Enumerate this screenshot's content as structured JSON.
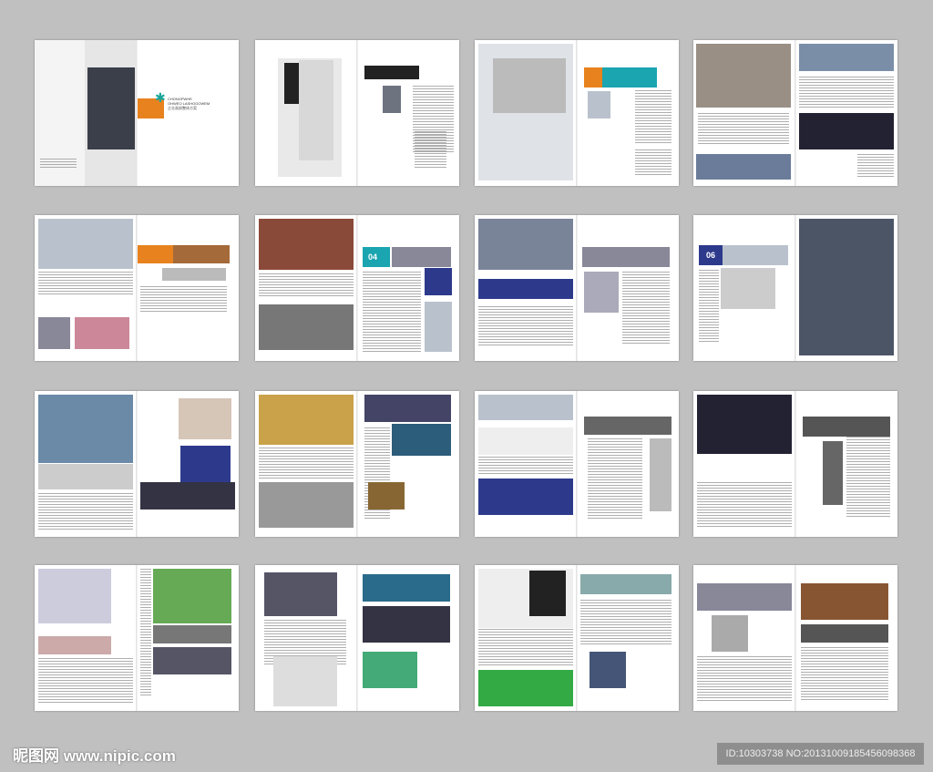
{
  "cover": {
    "logo_line1": "CHONGPWHE",
    "logo_line2": "OHWEO LASHOGOWEM",
    "logo_cn": "企业画册整体方案"
  },
  "page_numbers": [
    "04",
    "06"
  ],
  "colors": {
    "background": "#c0c0c0",
    "accent_orange": "#e8821e",
    "accent_teal": "#1aa5b0",
    "accent_blue": "#2d3a8c"
  },
  "watermark": {
    "text": "昵图网 www.nipic.com"
  },
  "image_id": {
    "text": "ID:10303738 NO:20131009185456098368"
  }
}
